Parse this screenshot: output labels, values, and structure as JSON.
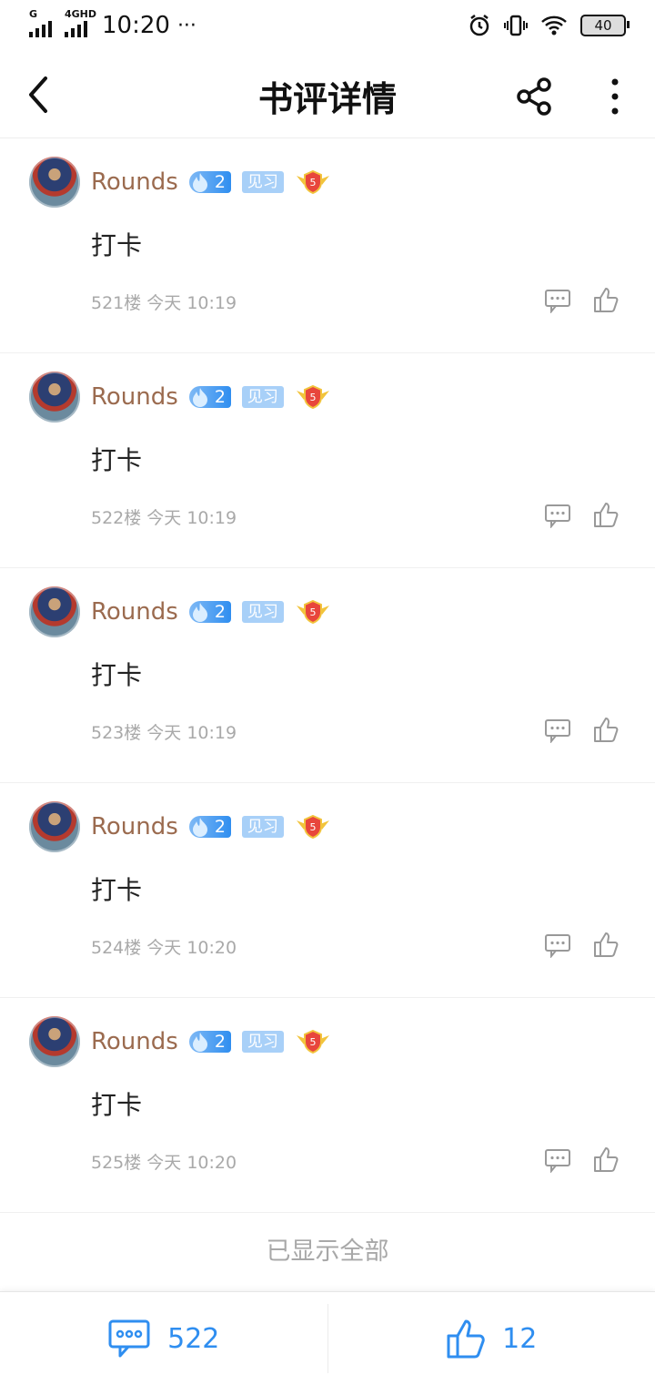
{
  "status_bar": {
    "net1": "G",
    "net2": "4GHD",
    "time": "10:20",
    "dots": "···",
    "battery": "40"
  },
  "header": {
    "title": "书评详情"
  },
  "comments": [
    {
      "username": "Rounds",
      "fire_level": "2",
      "tag": "见习",
      "medal_level": "5",
      "content": "打卡",
      "floor_info": "521楼 今天 10:19"
    },
    {
      "username": "Rounds",
      "fire_level": "2",
      "tag": "见习",
      "medal_level": "5",
      "content": "打卡",
      "floor_info": "522楼 今天 10:19"
    },
    {
      "username": "Rounds",
      "fire_level": "2",
      "tag": "见习",
      "medal_level": "5",
      "content": "打卡",
      "floor_info": "523楼 今天 10:19"
    },
    {
      "username": "Rounds",
      "fire_level": "2",
      "tag": "见习",
      "medal_level": "5",
      "content": "打卡",
      "floor_info": "524楼 今天 10:20"
    },
    {
      "username": "Rounds",
      "fire_level": "2",
      "tag": "见习",
      "medal_level": "5",
      "content": "打卡",
      "floor_info": "525楼 今天 10:20"
    }
  ],
  "end_text": "已显示全部",
  "bottom_bar": {
    "comment_count": "522",
    "like_count": "12"
  },
  "colors": {
    "accent": "#2f8ef0",
    "username": "#9b6b4f",
    "muted": "#a9a9a9"
  },
  "icons": [
    "back-arrow-icon",
    "share-icon",
    "more-vertical-icon",
    "fire-icon",
    "medal-icon",
    "reply-icon",
    "thumbs-up-icon",
    "comment-icon",
    "alarm-icon",
    "vibrate-icon",
    "wifi-icon",
    "battery-icon"
  ]
}
